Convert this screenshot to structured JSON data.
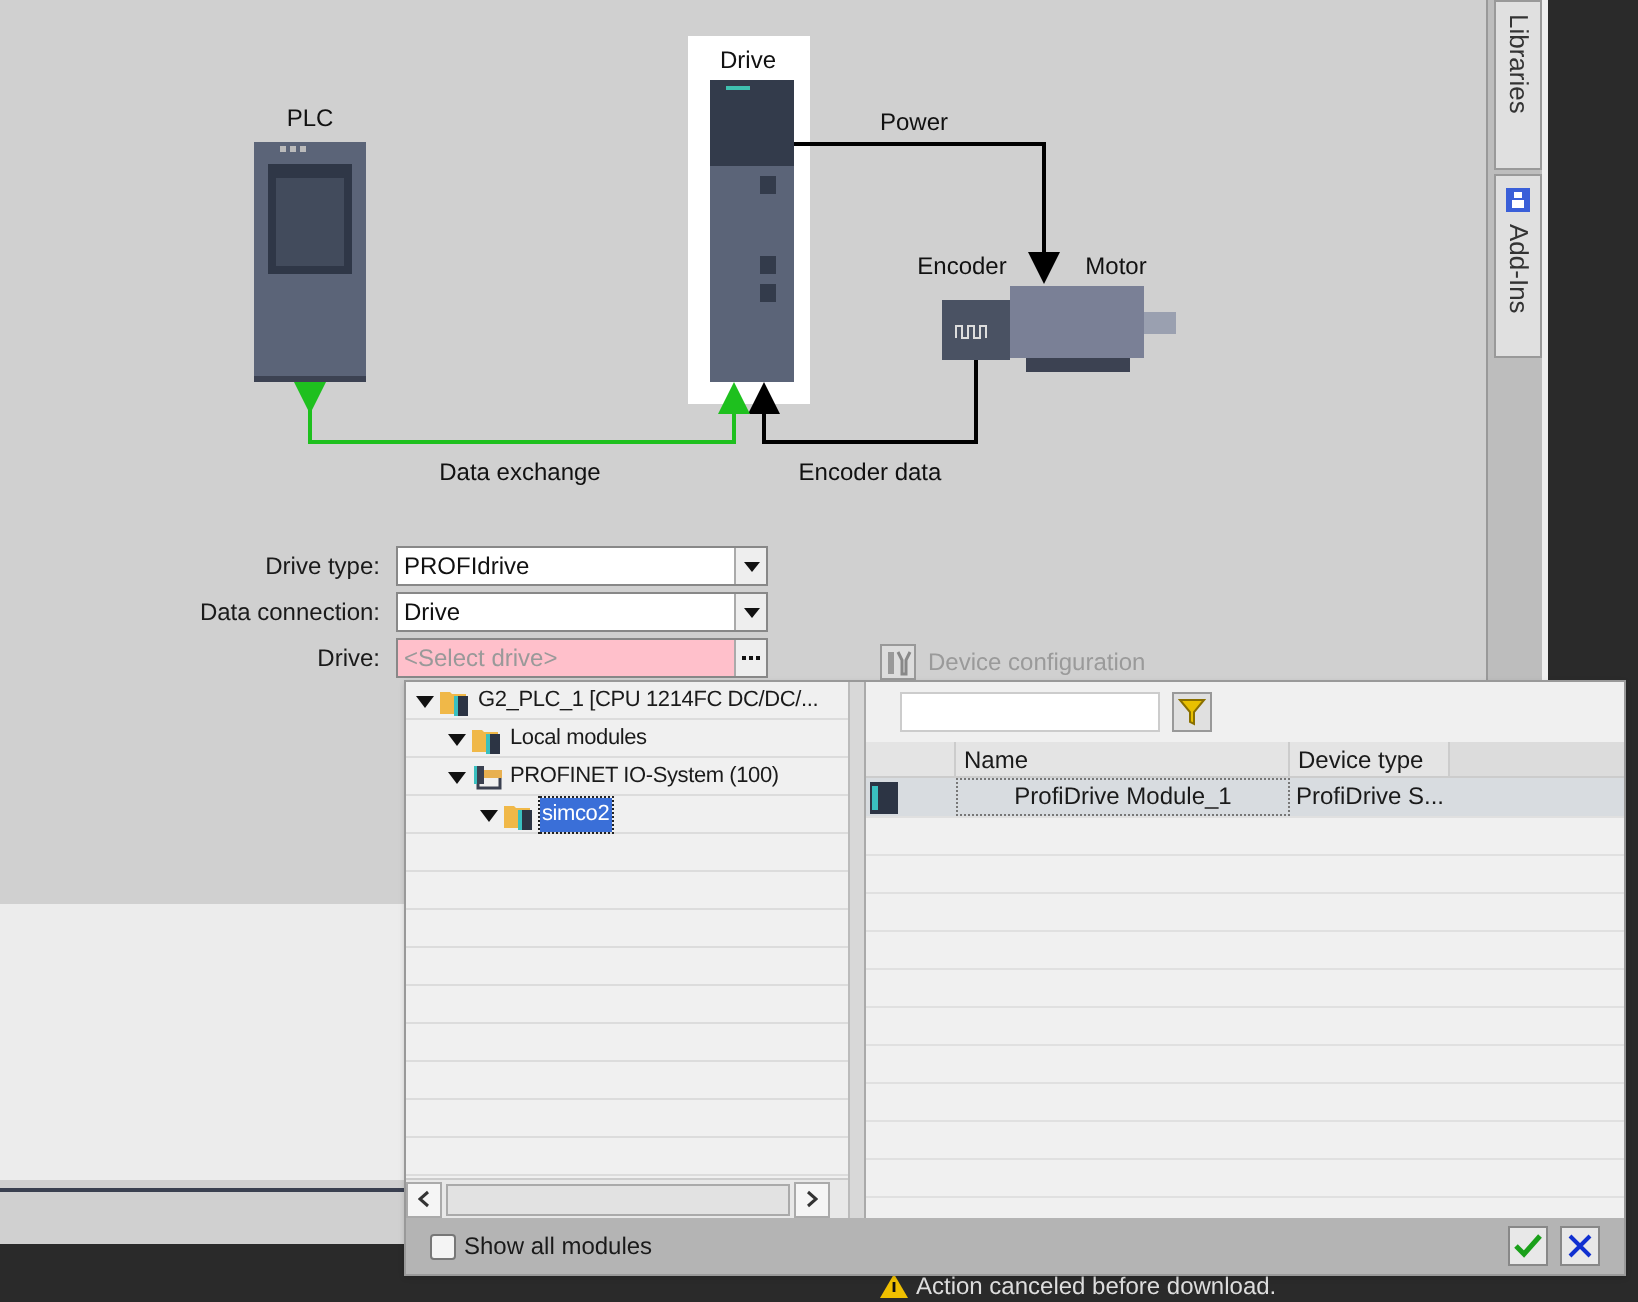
{
  "diagram": {
    "plc_label": "PLC",
    "drive_label": "Drive",
    "power_label": "Power",
    "encoder_label": "Encoder",
    "motor_label": "Motor",
    "data_exchange_label": "Data exchange",
    "encoder_data_label": "Encoder data"
  },
  "form": [
    {
      "label": "Drive type:",
      "value": "PROFIdrive",
      "kind": "dropdown"
    },
    {
      "label": "Data connection:",
      "value": "Drive",
      "kind": "dropdown"
    },
    {
      "label": "Drive:",
      "placeholder": "<Select drive>",
      "kind": "browse",
      "invalid": true
    }
  ],
  "device_configuration_button": {
    "label": "Device configuration",
    "disabled": true
  },
  "side_tabs": [
    {
      "label": "Libraries"
    },
    {
      "label": "Add-Ins"
    }
  ],
  "popup": {
    "tree": [
      {
        "label": "G2_PLC_1 [CPU 1214FC DC/DC/...",
        "kind": "device",
        "expanded": true,
        "selected": false,
        "children": [
          {
            "label": "Local modules",
            "kind": "device",
            "expanded": true,
            "selected": false
          },
          {
            "label": "PROFINET IO-System (100)",
            "kind": "network",
            "expanded": true,
            "selected": false,
            "children": [
              {
                "label": "simco2",
                "kind": "device",
                "expanded": true,
                "selected": true
              }
            ]
          }
        ]
      }
    ],
    "columns": [
      "Name",
      "Device type"
    ],
    "rows": [
      {
        "name": "ProfiDrive Module_1",
        "device_type": "ProfiDrive S...",
        "selected": true
      }
    ],
    "show_all_modules": {
      "label": "Show all modules",
      "checked": false
    }
  },
  "status_bar": {
    "message": "Action canceled before download."
  }
}
